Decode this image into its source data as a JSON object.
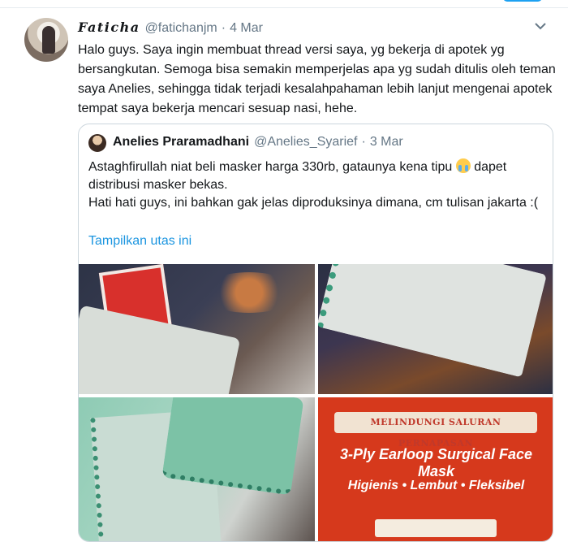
{
  "tweet": {
    "display_name": "Faticha",
    "handle": "@fatichanjm",
    "separator": "·",
    "date": "4 Mar",
    "text": "Halo guys. Saya ingin membuat thread versi saya, yg bekerja di apotek yg bersangkutan. Semoga bisa semakin memperjelas apa yg sudah ditulis oleh teman saya Anelies, sehingga tidak terjadi kesalahpahaman lebih lanjut mengenai apotek tempat saya bekerja mencari sesuap nasi, hehe.",
    "menu_icon": "chevron-down-icon"
  },
  "quoted": {
    "display_name": "Anelies Praramadhani",
    "handle": "@Anelies_Syarief",
    "separator": "·",
    "date": "3 Mar",
    "text_part1": "Astaghfirullah niat beli masker harga 330rb, gataunya kena tipu",
    "emoji": "loudly-crying-face-emoji",
    "text_part2": "dapet distribusi masker bekas.",
    "text_line2": "Hati hati guys, ini bahkan gak jelas diproduksinya dimana, cm tulisan jakarta :(",
    "show_thread": "Tampilkan utas ini"
  },
  "media": {
    "packaging_banner": "MELINDUNGI SALURAN PERNAPASAN",
    "product_name": "3-Ply Earloop Surgical Face Mask",
    "product_features": "Higienis • Lembut • Fleksibel"
  },
  "colors": {
    "link": "#1b95e0",
    "secondary_text": "#657786",
    "border": "#ccd6dd"
  }
}
